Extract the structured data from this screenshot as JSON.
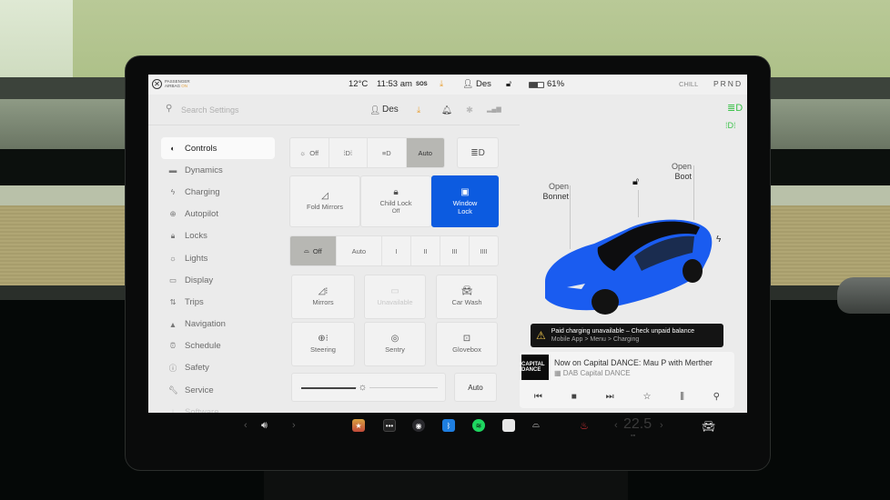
{
  "status_bar": {
    "airbag_label_line1": "PASSENGER",
    "airbag_label_line2": "AIRBAG",
    "airbag_state": "ON",
    "temperature": "12°C",
    "time": "11:53 am",
    "sos": "SOS",
    "driver_profile": "Des",
    "battery": "61%",
    "drive_mode": "CHILL",
    "gear": "PRND"
  },
  "settings_header": {
    "search_placeholder": "Search Settings",
    "profile": "Des"
  },
  "sidebar": {
    "items": [
      {
        "label": "Controls",
        "icon": "toggle-icon",
        "active": true
      },
      {
        "label": "Dynamics",
        "icon": "car-icon"
      },
      {
        "label": "Charging",
        "icon": "lightning-icon"
      },
      {
        "label": "Autopilot",
        "icon": "steering-wheel-icon"
      },
      {
        "label": "Locks",
        "icon": "lock-icon"
      },
      {
        "label": "Lights",
        "icon": "light-bulb-icon"
      },
      {
        "label": "Display",
        "icon": "display-icon"
      },
      {
        "label": "Trips",
        "icon": "trips-icon"
      },
      {
        "label": "Navigation",
        "icon": "navigation-icon"
      },
      {
        "label": "Schedule",
        "icon": "alarm-clock-icon"
      },
      {
        "label": "Safety",
        "icon": "safety-icon"
      },
      {
        "label": "Service",
        "icon": "wrench-icon"
      },
      {
        "label": "Software",
        "icon": "download-icon"
      }
    ]
  },
  "controls": {
    "lights_segment": [
      {
        "label": "Off",
        "icon": "sun-icon"
      },
      {
        "label": "",
        "icon": "parking-lights-icon"
      },
      {
        "label": "",
        "icon": "low-beam-icon"
      },
      {
        "label": "Auto",
        "selected": true
      }
    ],
    "auto_high_beam_icon": "auto-high-beam-icon",
    "fold_mirrors": "Fold Mirrors",
    "child_lock": "Child Lock",
    "child_lock_state": "Off",
    "window_lock_line1": "Window",
    "window_lock_line2": "Lock",
    "wiper_segment": [
      {
        "label": "Off",
        "icon": "wiper-icon",
        "selected": true
      },
      {
        "label": "Auto"
      },
      {
        "label": "I"
      },
      {
        "label": "II"
      },
      {
        "label": "III"
      },
      {
        "label": "IIII"
      }
    ],
    "mirrors": "Mirrors",
    "unavailable": "Unavailable",
    "car_wash": "Car Wash",
    "steering": "Steering",
    "sentry": "Sentry",
    "glovebox": "Glovebox",
    "brightness_level_percent": 45,
    "brightness_auto": "Auto"
  },
  "car_view": {
    "open_bonnet_1": "Open",
    "open_bonnet_2": "Bonnet",
    "open_boot_1": "Open",
    "open_boot_2": "Boot",
    "car_color": "#1a5cf0"
  },
  "alert": {
    "title": "Paid charging unavailable – Check unpaid balance",
    "subtitle": "Mobile App > Menu > Charging"
  },
  "media": {
    "station_logo": "CAPITAL DANCE",
    "title": "Now on Capital DANCE: Mau P with Merther",
    "source": "DAB Capital DANCE"
  },
  "taskbar": {
    "cabin_temp": "22.5",
    "apps": [
      "toybox-icon",
      "more-icon",
      "camera-icon",
      "bluetooth-icon",
      "spotify-icon",
      "calendar-icon",
      "wiper-icon",
      "seat-heater-icon"
    ]
  }
}
